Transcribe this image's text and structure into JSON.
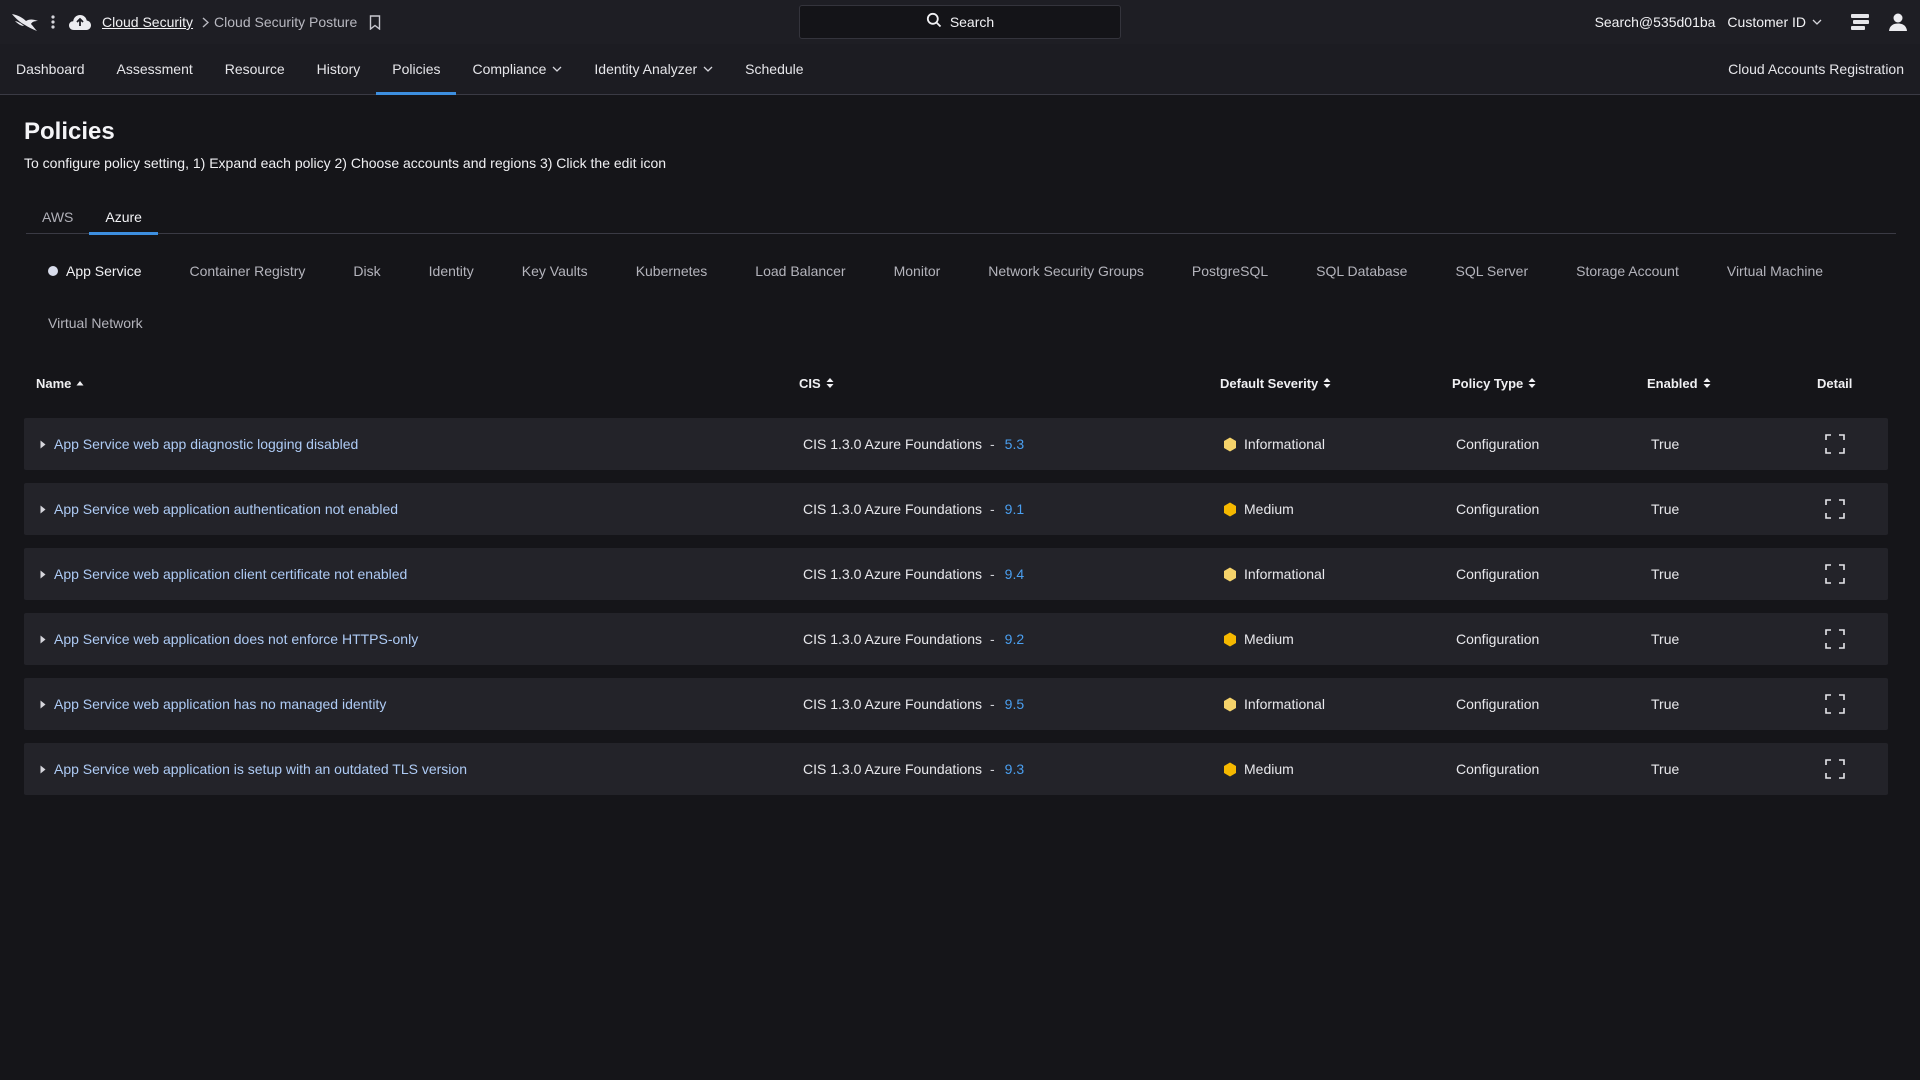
{
  "topbar": {
    "breadcrumb_root": "Cloud Security",
    "breadcrumb_current": "Cloud Security Posture",
    "search_label": "Search",
    "user_email": "Search@535d01ba",
    "customer_label": "Customer ID"
  },
  "nav": {
    "items": [
      {
        "label": "Dashboard"
      },
      {
        "label": "Assessment"
      },
      {
        "label": "Resource"
      },
      {
        "label": "History"
      },
      {
        "label": "Policies"
      },
      {
        "label": "Compliance"
      },
      {
        "label": "Identity Analyzer"
      },
      {
        "label": "Schedule"
      }
    ],
    "active": "Policies",
    "right_link": "Cloud Accounts Registration"
  },
  "page": {
    "title": "Policies",
    "description": "To configure policy setting, 1) Expand each policy 2) Choose accounts and regions 3) Click the edit icon"
  },
  "cloud_tabs": {
    "items": [
      {
        "label": "AWS"
      },
      {
        "label": "Azure"
      }
    ],
    "active": "Azure"
  },
  "services": {
    "active": "App Service",
    "items": [
      {
        "label": "App Service"
      },
      {
        "label": "Container Registry"
      },
      {
        "label": "Disk"
      },
      {
        "label": "Identity"
      },
      {
        "label": "Key Vaults"
      },
      {
        "label": "Kubernetes"
      },
      {
        "label": "Load Balancer"
      },
      {
        "label": "Monitor"
      },
      {
        "label": "Network Security Groups"
      },
      {
        "label": "PostgreSQL"
      },
      {
        "label": "SQL Database"
      },
      {
        "label": "SQL Server"
      },
      {
        "label": "Storage Account"
      },
      {
        "label": "Virtual Machine"
      },
      {
        "label": "Virtual Network"
      }
    ]
  },
  "table": {
    "columns": {
      "name": "Name",
      "cis": "CIS",
      "severity": "Default Severity",
      "policy_type": "Policy Type",
      "enabled": "Enabled",
      "detail": "Detail"
    },
    "rows": [
      {
        "name": "App Service web app diagnostic logging disabled",
        "cis": "CIS 1.3.0 Azure Foundations",
        "cis_sep": "-",
        "cis_ref": "5.3",
        "severity": "Informational",
        "policy_type": "Configuration",
        "enabled": "True"
      },
      {
        "name": "App Service web application authentication not enabled",
        "cis": "CIS 1.3.0 Azure Foundations",
        "cis_sep": "-",
        "cis_ref": "9.1",
        "severity": "Medium",
        "policy_type": "Configuration",
        "enabled": "True"
      },
      {
        "name": "App Service web application client certificate not enabled",
        "cis": "CIS 1.3.0 Azure Foundations",
        "cis_sep": "-",
        "cis_ref": "9.4",
        "severity": "Informational",
        "policy_type": "Configuration",
        "enabled": "True"
      },
      {
        "name": "App Service web application does not enforce HTTPS-only",
        "cis": "CIS 1.3.0 Azure Foundations",
        "cis_sep": "-",
        "cis_ref": "9.2",
        "severity": "Medium",
        "policy_type": "Configuration",
        "enabled": "True"
      },
      {
        "name": "App Service web application has no managed identity",
        "cis": "CIS 1.3.0 Azure Foundations",
        "cis_sep": "-",
        "cis_ref": "9.5",
        "severity": "Informational",
        "policy_type": "Configuration",
        "enabled": "True"
      },
      {
        "name": "App Service web application is setup with an outdated TLS version",
        "cis": "CIS 1.3.0 Azure Foundations",
        "cis_sep": "-",
        "cis_ref": "9.3",
        "severity": "Medium",
        "policy_type": "Configuration",
        "enabled": "True"
      }
    ]
  },
  "colors": {
    "accent": "#3d8fe0",
    "link": "#4a9ff0",
    "severity_informational": "#f5d36b",
    "severity_medium": "#f5b800"
  },
  "icons": {
    "logo": "falcon-logo-icon",
    "menu": "kebab-menu-icon",
    "cloud": "cloud-icon",
    "bookmark": "bookmark-icon",
    "search": "search-icon",
    "notifications": "stacked-panels-icon",
    "profile": "user-icon",
    "expand": "expand-corners-icon"
  }
}
